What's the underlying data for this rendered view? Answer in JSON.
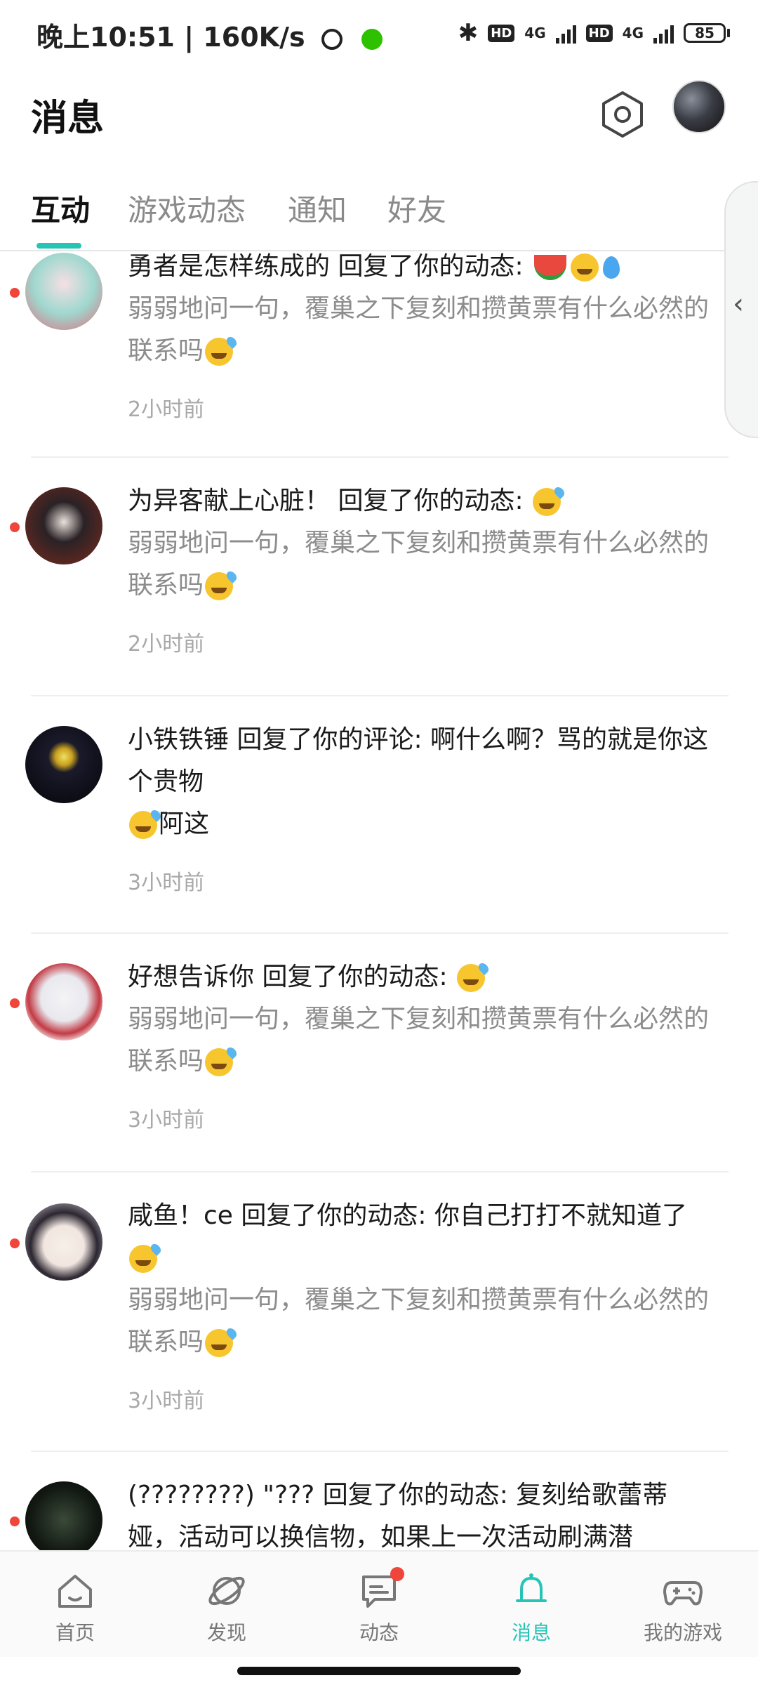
{
  "status_bar": {
    "time": "晚上10:51",
    "speed": "160K/s",
    "hd1": "HD",
    "net1": "4G",
    "hd2": "HD",
    "net2": "4G",
    "battery": "85"
  },
  "header": {
    "title": "消息"
  },
  "tabs": [
    {
      "label": "互动",
      "active": true
    },
    {
      "label": "游戏动态"
    },
    {
      "label": "通知"
    },
    {
      "label": "好友"
    }
  ],
  "messages": [
    {
      "headline": "勇者是怎样练成的 回复了你的动态: ",
      "quote": "弱弱地问一句，覆巢之下复刻和攒黄票有什么必然的联系吗",
      "time": "2小时前"
    },
    {
      "headline": "为异客献上心脏！ 回复了你的动态: ",
      "quote": "弱弱地问一句，覆巢之下复刻和攒黄票有什么必然的联系吗",
      "time": "2小时前"
    },
    {
      "headline": "小铁铁锤 回复了你的评论: 啊什么啊？骂的就是你这个贵物",
      "quote_b": "阿这",
      "time": "3小时前"
    },
    {
      "headline": "好想告诉你 回复了你的动态: ",
      "quote": "弱弱地问一句，覆巢之下复刻和攒黄票有什么必然的联系吗",
      "time": "3小时前"
    },
    {
      "headline": "咸鱼！ce 回复了你的动态: 你自己打打不就知道了",
      "quote": "弱弱地问一句，覆巢之下复刻和攒黄票有什么必然的联系吗",
      "time": "3小时前"
    },
    {
      "headline": "(????????) \"??? 回复了你的动态: 复刻给歌蕾蒂娅，活动可以换信物，如果上一次活动刷满潜"
    }
  ],
  "bottom_nav": [
    {
      "label": "首页",
      "icon": "home-icon"
    },
    {
      "label": "发现",
      "icon": "planet-icon"
    },
    {
      "label": "动态",
      "icon": "chat-icon"
    },
    {
      "label": "消息",
      "icon": "bell-icon",
      "active": true
    },
    {
      "label": "我的游戏",
      "icon": "gamepad-icon"
    }
  ],
  "colors": {
    "accent": "#27c4b6",
    "unread": "#f0453a"
  }
}
